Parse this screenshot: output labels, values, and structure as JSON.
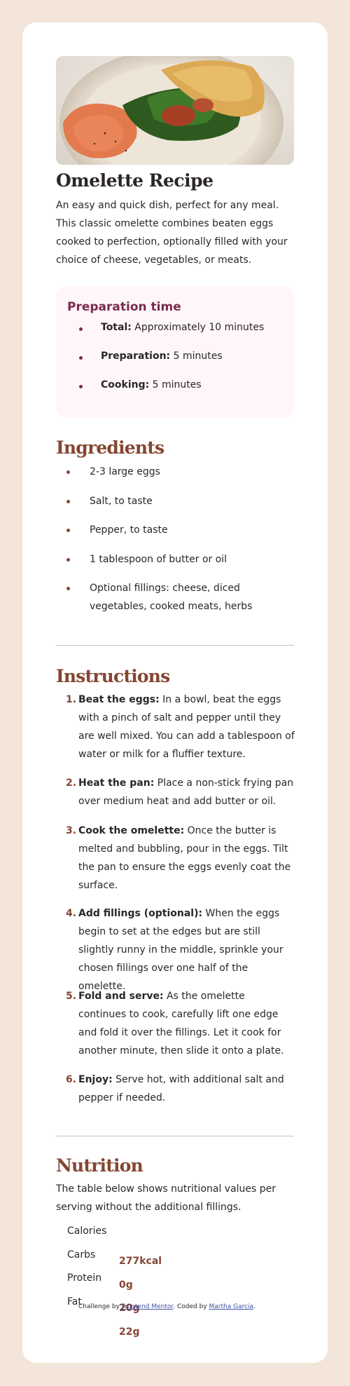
{
  "recipe": {
    "title": "Omelette Recipe",
    "intro": "An easy and quick dish, perfect for any meal. This classic omelette combines beaten eggs cooked to perfection, optionally filled with your choice of cheese, vegetables, or meats."
  },
  "preparation": {
    "title": "Preparation time",
    "items": [
      {
        "label": "Total:",
        "value": " Approximately 10 minutes"
      },
      {
        "label": "Preparation:",
        "value": " 5 minutes"
      },
      {
        "label": "Cooking:",
        "value": " 5 minutes"
      }
    ]
  },
  "ingredients": {
    "title": "Ingredients",
    "items": [
      "2-3 large eggs",
      "Salt, to taste",
      "Pepper, to taste",
      "1 tablespoon of butter or oil",
      "Optional fillings: cheese, diced vegetables, cooked meats, herbs"
    ]
  },
  "instructions": {
    "title": "Instructions",
    "steps": [
      {
        "num": "1.",
        "label": "Beat the eggs:",
        "text": " In a bowl, beat the eggs with a pinch of salt and pepper until they are well mixed. You can add a tablespoon of water or milk for a fluffier texture."
      },
      {
        "num": "2.",
        "label": "Heat the pan:",
        "text": " Place a non-stick frying pan over medium heat and add butter or oil."
      },
      {
        "num": "3.",
        "label": "Cook the omelette:",
        "text": " Once the butter is melted and bubbling, pour in the eggs. Tilt the pan to ensure the eggs evenly coat the surface."
      },
      {
        "num": "4.",
        "label": "Add fillings (optional):",
        "text": " When the eggs begin to set at the edges but are still slightly runny in the middle, sprinkle your chosen fillings over one half of the omelette."
      },
      {
        "num": "5.",
        "label": "Fold and serve:",
        "text": " As the omelette continues to cook, carefully lift one edge and fold it over the fillings. Let it cook for another minute, then slide it onto a plate."
      },
      {
        "num": "6.",
        "label": "Enjoy:",
        "text": " Serve hot, with additional salt and pepper if needed."
      }
    ]
  },
  "nutrition": {
    "title": "Nutrition",
    "intro": "The table below shows nutritional values per serving without the additional fillings.",
    "labels": [
      "Calories",
      "Carbs",
      "Protein",
      "Fat"
    ],
    "values": [
      "277kcal",
      "0g",
      "20g",
      "22g"
    ]
  },
  "attribution": {
    "prefix": "Challenge by ",
    "challenge_link": "Frontend Mentor",
    "middle": ". Coded by ",
    "author_link": "Martha Garcia",
    "suffix": "."
  },
  "colors": {
    "page_bg": "#f3e5d9",
    "card_bg": "#ffffff",
    "heading_brown": "#854632",
    "prep_purple": "#7a2b4d",
    "prep_bg": "#fff6fa",
    "link_blue": "#3e52a3"
  }
}
